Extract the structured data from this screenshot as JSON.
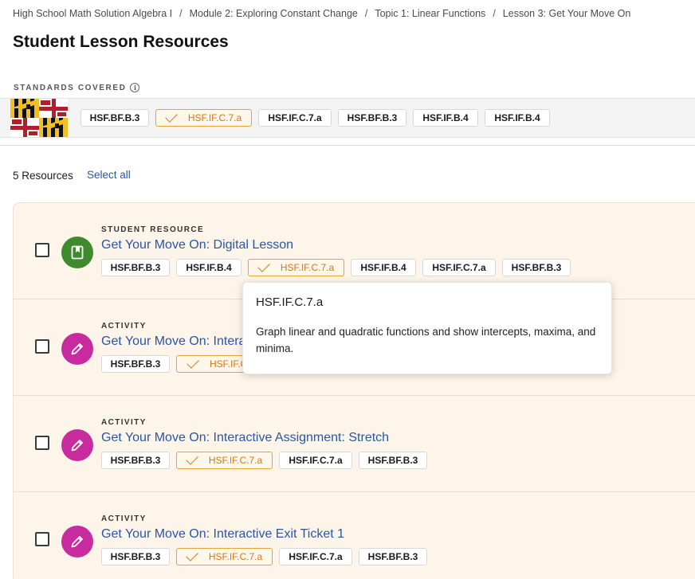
{
  "breadcrumb": {
    "items": [
      "High School Math Solution Algebra I",
      "Module 2: Exploring Constant Change",
      "Topic 1: Linear Functions",
      "Lesson 3: Get Your Move On"
    ],
    "separator": "/"
  },
  "page_title": "Student Lesson Resources",
  "standards": {
    "label": "STANDARDS COVERED",
    "info_icon": "i",
    "chips": [
      {
        "label": "HSF.BF.B.3",
        "selected": false
      },
      {
        "label": "HSF.IF.C.7.a",
        "selected": true
      },
      {
        "label": "HSF.IF.C.7.a",
        "selected": false
      },
      {
        "label": "HSF.BF.B.3",
        "selected": false
      },
      {
        "label": "HSF.IF.B.4",
        "selected": false
      },
      {
        "label": "HSF.IF.B.4",
        "selected": false
      }
    ]
  },
  "resources": {
    "count_label": "5 Resources",
    "select_all_label": "Select all",
    "items": [
      {
        "type": "STUDENT RESOURCE",
        "title": "Get Your Move On: Digital Lesson",
        "icon": "book-icon",
        "chips": [
          "HSF.BF.B.3",
          "HSF.IF.B.4",
          "HSF.IF.C.7.a",
          "HSF.IF.B.4",
          "HSF.IF.C.7.a",
          "HSF.BF.B.3"
        ],
        "selected_chip": 2
      },
      {
        "type": "ACTIVITY",
        "title": "Get Your Move On: Intera",
        "icon": "pencil-icon",
        "chips": [
          "HSF.BF.B.3",
          "HSF.IF.C"
        ],
        "selected_chip": 1
      },
      {
        "type": "ACTIVITY",
        "title": "Get Your Move On: Interactive Assignment: Stretch",
        "icon": "pencil-icon",
        "chips": [
          "HSF.BF.B.3",
          "HSF.IF.C.7.a",
          "HSF.IF.C.7.a",
          "HSF.BF.B.3"
        ],
        "selected_chip": 1
      },
      {
        "type": "ACTIVITY",
        "title": "Get Your Move On: Interactive Exit Ticket 1",
        "icon": "pencil-icon",
        "chips": [
          "HSF.BF.B.3",
          "HSF.IF.C.7.a",
          "HSF.IF.C.7.a",
          "HSF.BF.B.3"
        ],
        "selected_chip": 1
      }
    ]
  },
  "tooltip": {
    "title": "HSF.IF.C.7.a",
    "body": "Graph linear and quadratic functions and show intercepts, maxima, and minima."
  },
  "colors": {
    "link": "#2a55a8",
    "selected_chip_border": "#e8a23a",
    "selected_chip_text": "#d4761a",
    "card_bg": "#fdf5ea",
    "book_icon_bg": "#3f8a2c",
    "pencil_icon_bg": "#c82b9e"
  }
}
